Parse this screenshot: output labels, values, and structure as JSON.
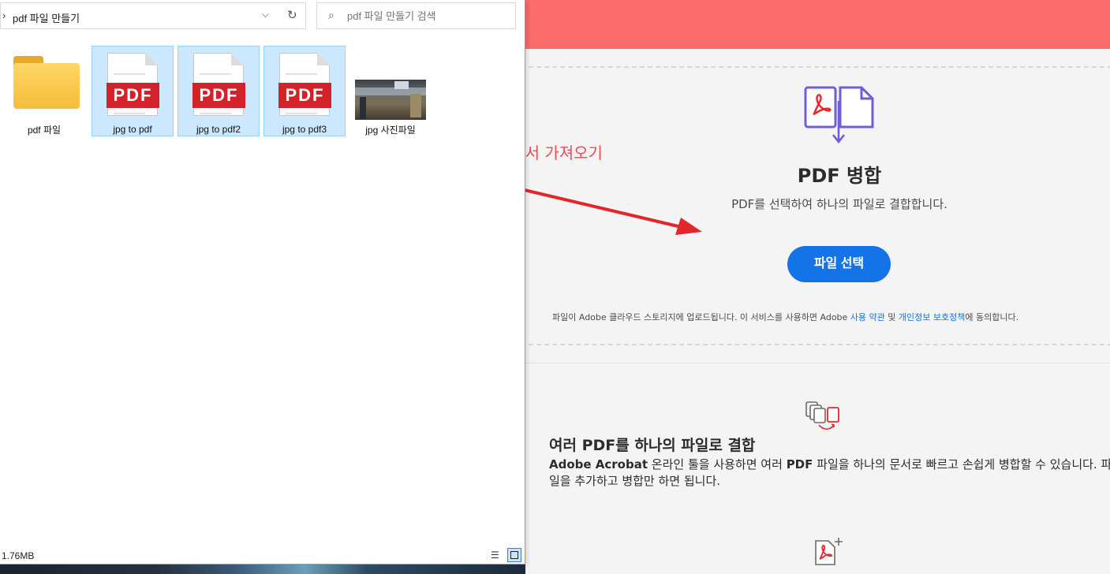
{
  "explorer": {
    "breadcrumb": "pdf 파일 만들기",
    "breadcrumb_chevron": "›",
    "search_placeholder": "pdf 파일 만들기 검색",
    "items": [
      {
        "label": "pdf 파일",
        "type": "folder",
        "selected": false
      },
      {
        "label": "jpg to pdf",
        "type": "pdf",
        "selected": true
      },
      {
        "label": "jpg to pdf2",
        "type": "pdf",
        "selected": true
      },
      {
        "label": "jpg to pdf3",
        "type": "pdf",
        "selected": true
      },
      {
        "label": "jpg 사진파일",
        "type": "image",
        "selected": false
      }
    ],
    "pdf_badge": "PDF",
    "status_size": "1.76MB"
  },
  "annotation": {
    "text": "드래그해서 가져오기",
    "color": "#ec4b52"
  },
  "acrobat": {
    "banner_color": "#fa6b6b",
    "title": "PDF 병합",
    "subtitle": "PDF를 선택하여 하나의 파일로 결합합니다.",
    "select_button": "파일 선택",
    "legal_prefix": "파일이 Adobe 클라우드 스토리지에 업로드됩니다. 이 서비스를 사용하면 Adobe ",
    "legal_terms": "사용 약관",
    "legal_and": " 및 ",
    "legal_privacy": "개인정보 보호정책",
    "legal_suffix": "에 동의합니다.",
    "feature_title": "여러 PDF를 하나의 파일로 결합",
    "feature_body_bold": "Adobe Acrobat",
    "feature_body_1": " 온라인 툴을 사용하면 여러 ",
    "feature_body_bold2": "PDF",
    "feature_body_2": " 파일을 하나의 문서로 빠르고 손쉽게 병합할 수 있습니다. 파일을 추가하고 병합만 하면 됩니다.",
    "accent_color": "#1473e6"
  }
}
